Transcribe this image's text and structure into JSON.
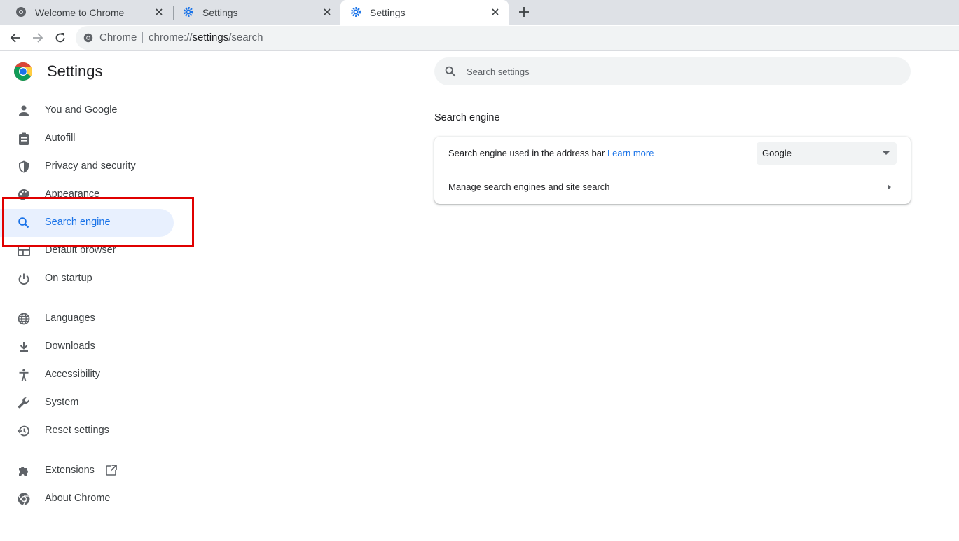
{
  "tabs": [
    {
      "title": "Welcome to Chrome",
      "icon": "chrome-globe-icon",
      "active": false
    },
    {
      "title": "Settings",
      "icon": "gear-icon",
      "active": false
    },
    {
      "title": "Settings",
      "icon": "gear-icon",
      "active": true
    }
  ],
  "omnibox": {
    "chip": "Chrome",
    "url_prefix": "chrome://",
    "url_host": "settings",
    "url_path": "/search"
  },
  "sidebar": {
    "title": "Settings",
    "items": [
      {
        "label": "You and Google",
        "icon": "person-icon"
      },
      {
        "label": "Autofill",
        "icon": "clipboard-icon"
      },
      {
        "label": "Privacy and security",
        "icon": "shield-icon"
      },
      {
        "label": "Appearance",
        "icon": "palette-icon"
      },
      {
        "label": "Search engine",
        "icon": "search-icon",
        "active": true
      },
      {
        "label": "Default browser",
        "icon": "browser-window-icon"
      },
      {
        "label": "On startup",
        "icon": "power-icon"
      },
      {
        "label": "Languages",
        "icon": "globe-icon"
      },
      {
        "label": "Downloads",
        "icon": "download-icon"
      },
      {
        "label": "Accessibility",
        "icon": "accessibility-icon"
      },
      {
        "label": "System",
        "icon": "wrench-icon"
      },
      {
        "label": "Reset settings",
        "icon": "history-icon"
      },
      {
        "label": "Extensions",
        "icon": "puzzle-icon"
      },
      {
        "label": "About Chrome",
        "icon": "chrome-logo-icon"
      }
    ]
  },
  "search": {
    "placeholder": "Search settings"
  },
  "main": {
    "section_title": "Search engine",
    "row1_label": "Search engine used in the address bar",
    "row1_link": "Learn more",
    "row1_select_value": "Google",
    "row2_label": "Manage search engines and site search"
  },
  "colors": {
    "accent": "#1a73e8",
    "active_bg": "#e8f0fe",
    "highlight_border": "#e00000"
  }
}
